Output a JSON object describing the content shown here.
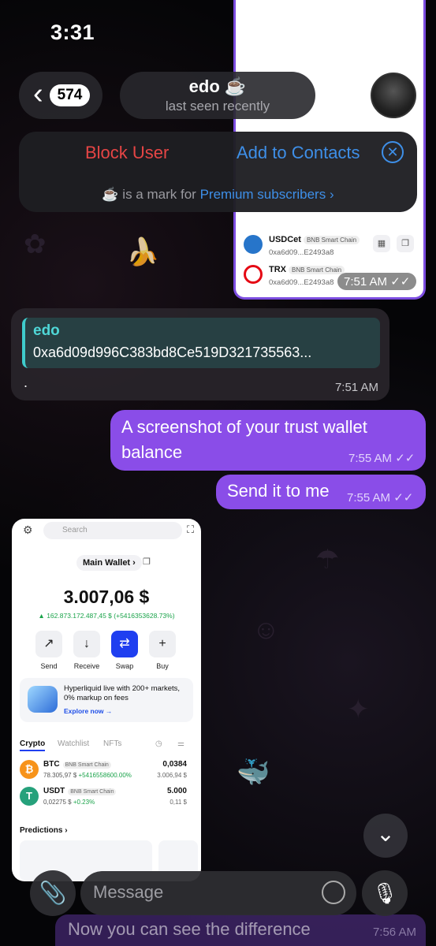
{
  "status": {
    "time": "3:31"
  },
  "header": {
    "back_count": "574",
    "name": "edo",
    "status": "last seen recently"
  },
  "action_bar": {
    "block": "Block User",
    "add": "Add to Contacts",
    "premium_prefix": "is a mark for",
    "premium_link": "Premium subscribers"
  },
  "top_image": {
    "rows": [
      {
        "symbol": "USDCet",
        "network": "BNB Smart Chain",
        "address": "0xa6d09...E2493a8",
        "color": "#2775ca"
      },
      {
        "symbol": "TRX",
        "network": "BNB Smart Chain",
        "address": "0xa6d09...E2493a8",
        "color": "#e50914"
      }
    ],
    "time": "7:51 AM"
  },
  "received": {
    "quote_name": "edo",
    "quote_text": "0xa6d09d996C383bd8Ce519D321735563...",
    "body": ".",
    "time": "7:51 AM"
  },
  "outgoing": [
    {
      "text": "A screenshot of your trust wallet balance",
      "time": "7:55 AM"
    },
    {
      "text": "Send it to me",
      "time": "7:55 AM"
    }
  ],
  "wallet": {
    "search_placeholder": "Search",
    "wallet_name": "Main Wallet",
    "balance": "3.007,06 $",
    "gain": "▲ 162.873.172.487,45 $ (+5416353628.73%)",
    "actions": [
      "Send",
      "Receive",
      "Swap",
      "Buy"
    ],
    "promo_text": "Hyperliquid live with 200+ markets, 0% markup on fees",
    "promo_link": "Explore now",
    "tabs": [
      "Crypto",
      "Watchlist",
      "NFTs"
    ],
    "tokens": [
      {
        "symbol": "BTC",
        "network": "BNB Smart Chain",
        "price": "78.305,97 $",
        "change": "+5416558600.00%",
        "amount": "0,0384",
        "value": "3.006,94 $",
        "color": "#f7931a",
        "glyph": "₿"
      },
      {
        "symbol": "USDT",
        "network": "BNB Smart Chain",
        "price": "0,02275 $",
        "change": "+0.23%",
        "amount": "5.000",
        "value": "0,11 $",
        "color": "#26a17b",
        "glyph": "T"
      }
    ],
    "predictions": "Predictions"
  },
  "composer": {
    "placeholder": "Message"
  },
  "last_message": {
    "text": "Now you can see the difference",
    "time": "7:56 AM"
  }
}
